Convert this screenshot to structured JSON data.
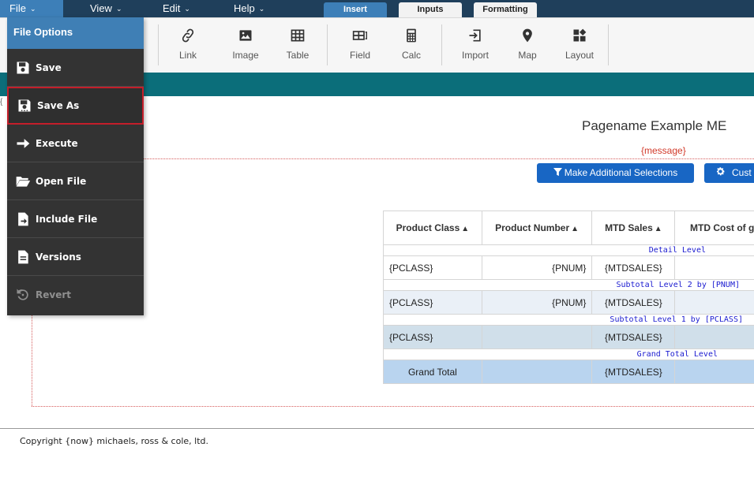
{
  "menubar": {
    "file": "File",
    "view": "View",
    "edit": "Edit",
    "help": "Help"
  },
  "tabs": {
    "insert": "Insert",
    "inputs": "Inputs",
    "formatting": "Formatting"
  },
  "toolbar": {
    "link": "Link",
    "image": "Image",
    "table": "Table",
    "field": "Field",
    "calc": "Calc",
    "import": "Import",
    "map": "Map",
    "layout": "Layout"
  },
  "page": {
    "title": "Pagename Example ME",
    "message": "{message}",
    "brace": "{",
    "make_selections": "Make Additional Selections",
    "customize": "Cust"
  },
  "table": {
    "headers": [
      "Product Class",
      "Product Number",
      "MTD Sales",
      "MTD Cost of g"
    ],
    "detail_level": "Detail Level",
    "subtotal2": "Subtotal Level 2 by [PNUM]",
    "subtotal1": "Subtotal Level 1 by [PCLASS]",
    "grand_level": "Grand Total Level",
    "pclass": "{PCLASS}",
    "pnum": "{PNUM}",
    "mtdsales": "{MTDSALES}",
    "grand_total": "Grand Total"
  },
  "footer": "Copyright {now} michaels, ross & cole, ltd.",
  "dropdown": {
    "header": "File Options",
    "items": [
      "Save",
      "Save As",
      "Execute",
      "Open File",
      "Include File",
      "Versions",
      "Revert"
    ]
  },
  "colors": {
    "menubar": "#1f3f5b",
    "accent": "#3d7fb8",
    "teal": "#0b6e7a",
    "button": "#1866c4",
    "highlight": "#c41e2a"
  }
}
